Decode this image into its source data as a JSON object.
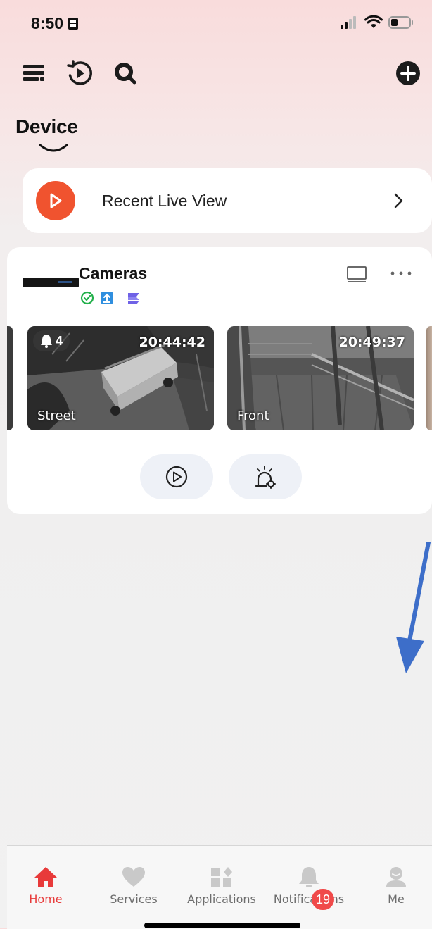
{
  "status_bar": {
    "time": "8:50"
  },
  "device_section": {
    "title": "Device"
  },
  "recent_live_view": {
    "label": "Recent Live View"
  },
  "cameras": {
    "title": "Cameras",
    "thumbnails": [
      {
        "name": "Street",
        "time": "20:44:42",
        "alert_count": "4"
      },
      {
        "name": "Front",
        "time": "20:49:37"
      }
    ]
  },
  "tabbar": {
    "items": [
      {
        "label": "Home",
        "icon": "home-icon",
        "active": true
      },
      {
        "label": "Services",
        "icon": "heart-icon"
      },
      {
        "label": "Applications",
        "icon": "applications-icon"
      },
      {
        "label": "Notifications",
        "icon": "bell-icon",
        "badge": "19"
      },
      {
        "label": "Me",
        "icon": "user-icon"
      }
    ]
  },
  "colors": {
    "accent": "#e83a3a",
    "live_view_icon": "#f0532f",
    "annotation_arrow": "#3d6ec9"
  }
}
